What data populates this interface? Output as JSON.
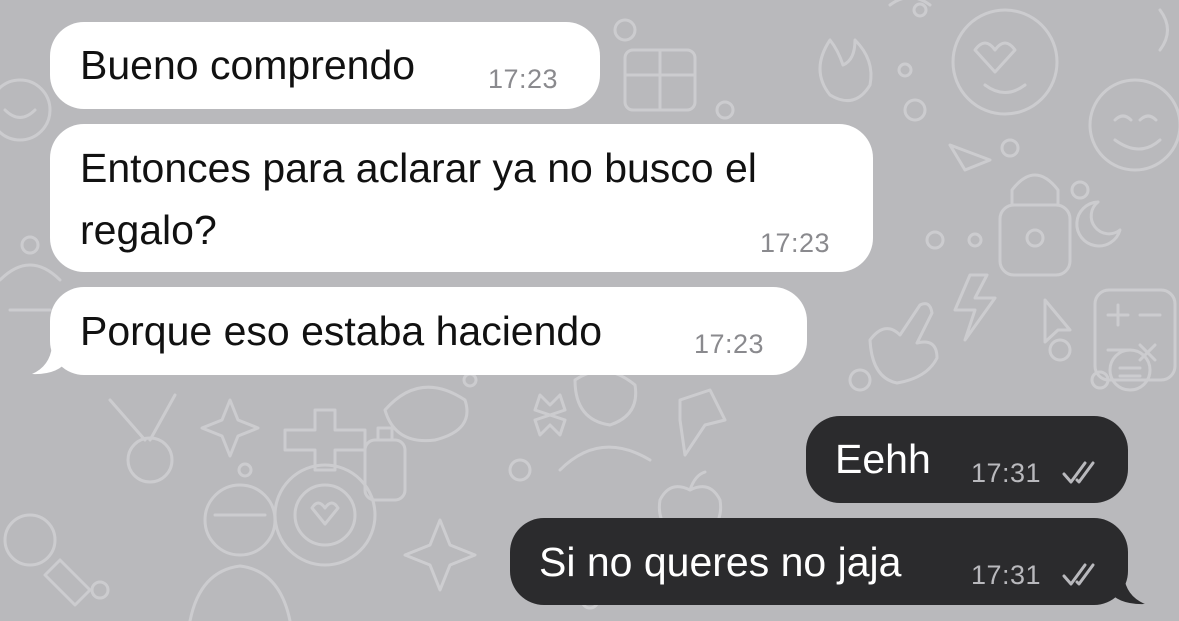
{
  "chat": {
    "messages": [
      {
        "direction": "incoming",
        "text_lines": [
          "Bueno comprendo"
        ],
        "time": "17:23"
      },
      {
        "direction": "incoming",
        "text_lines": [
          "Entonces para aclarar ya no busco el",
          "regalo?"
        ],
        "time": "17:23"
      },
      {
        "direction": "incoming",
        "text_lines": [
          "Porque eso estaba haciendo"
        ],
        "time": "17:23"
      },
      {
        "direction": "outgoing",
        "text_lines": [
          "Eehh"
        ],
        "time": "17:31",
        "status_icon": "double-check-icon"
      },
      {
        "direction": "outgoing",
        "text_lines": [
          "Si no queres no jaja"
        ],
        "time": "17:31",
        "status_icon": "double-check-icon"
      }
    ]
  },
  "theme": {
    "wallpaper_color": "#b9b9bc",
    "incoming_bubble_color": "#ffffff",
    "outgoing_bubble_color": "#2b2b2d",
    "incoming_text_color": "#111111",
    "outgoing_text_color": "#ffffff"
  }
}
